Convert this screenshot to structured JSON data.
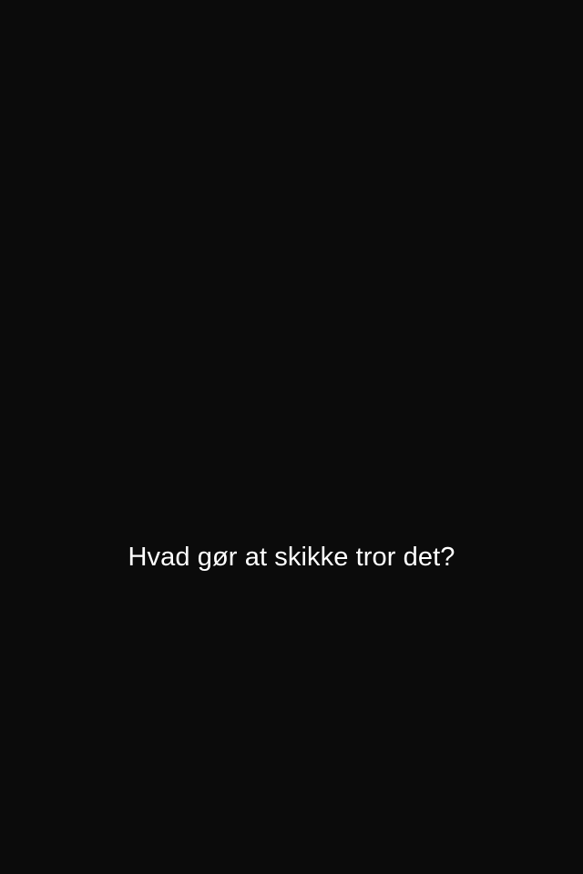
{
  "screen": {
    "background_color": "#0b0b0b",
    "caption": {
      "text": "Hvad gør at skikke tror det?",
      "color": "#ffffff"
    }
  }
}
